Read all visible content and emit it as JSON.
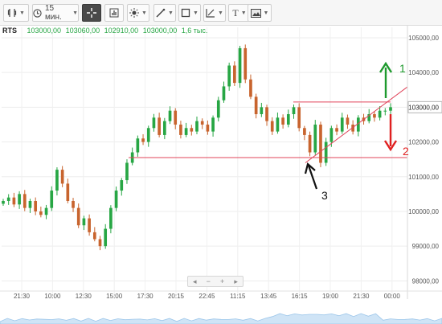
{
  "toolbar": {
    "chart_type_icon": "candlestick-icon",
    "interval_label": "15 мин.",
    "crosshair_icon": "crosshair-icon",
    "chart_style_icon": "bar-chart-icon",
    "indicators_icon": "sun-icon",
    "draw_line_icon": "pencil-line-icon",
    "shapes_icon": "square-icon",
    "fib_icon": "fibonacci-icon",
    "text_label": "T",
    "image_icon": "picture-icon"
  },
  "symbol": {
    "name": "RTS",
    "open": "103000,00",
    "high": "103060,00",
    "low": "102910,00",
    "close": "103000,00",
    "volume": "1,6 тыс."
  },
  "nav": {
    "left": "◂",
    "minus": "−",
    "plus": "+",
    "right": "▸"
  },
  "colors": {
    "up": "#27a644",
    "down": "#c8642e",
    "line": "#e0445a",
    "green_arrow": "#1e9a2e",
    "red_arrow": "#e02020",
    "price_tag_bg": "#ffffff"
  },
  "chart_data": {
    "type": "candlestick",
    "y_ticks": [
      "105000,00",
      "104000,00",
      "103000,00",
      "102000,00",
      "101000,00",
      "100000,00",
      "99000,00",
      "98000,00"
    ],
    "y_tick_values": [
      105000,
      104000,
      103000,
      102000,
      101000,
      100000,
      99000,
      98000
    ],
    "ylim": [
      97800,
      105300
    ],
    "x_ticks": [
      "21:30",
      "10:00",
      "12:30",
      "15:00",
      "17:30",
      "20:15",
      "22:45",
      "11:15",
      "13:45",
      "16:15",
      "19:00",
      "21:30",
      "00:00"
    ],
    "current_price": "103000,00",
    "current_value": 103000,
    "annotations": [
      {
        "label": "1",
        "direction": "up",
        "color": "green"
      },
      {
        "label": "2",
        "direction": "down",
        "color": "red"
      },
      {
        "label": "3",
        "direction": "pointer",
        "color": "black"
      }
    ],
    "trendlines": [
      {
        "name": "resistance",
        "y": 103150
      },
      {
        "name": "support",
        "y": 101550
      },
      {
        "name": "rising-trendline",
        "from": 101400,
        "to": 103400
      }
    ],
    "close_path": [
      100300,
      100400,
      100200,
      100500,
      100100,
      100300,
      100000,
      99900,
      100100,
      100600,
      101200,
      100800,
      100300,
      100100,
      99600,
      99800,
      99400,
      99200,
      99000,
      99500,
      100100,
      100600,
      100900,
      101400,
      101700,
      102100,
      102000,
      102400,
      102700,
      102200,
      102600,
      102900,
      102500,
      102200,
      102400,
      102300,
      102600,
      102500,
      102300,
      102700,
      103200,
      103600,
      104200,
      103700,
      104700,
      103800,
      103300,
      102800,
      103000,
      102600,
      102300,
      102700,
      102500,
      102800,
      103000,
      102400,
      102200,
      101700,
      102500,
      101400,
      102000,
      102400,
      102300,
      102700,
      102500,
      102300,
      102700,
      102600,
      102800,
      102700,
      102900,
      102900,
      103000
    ]
  }
}
